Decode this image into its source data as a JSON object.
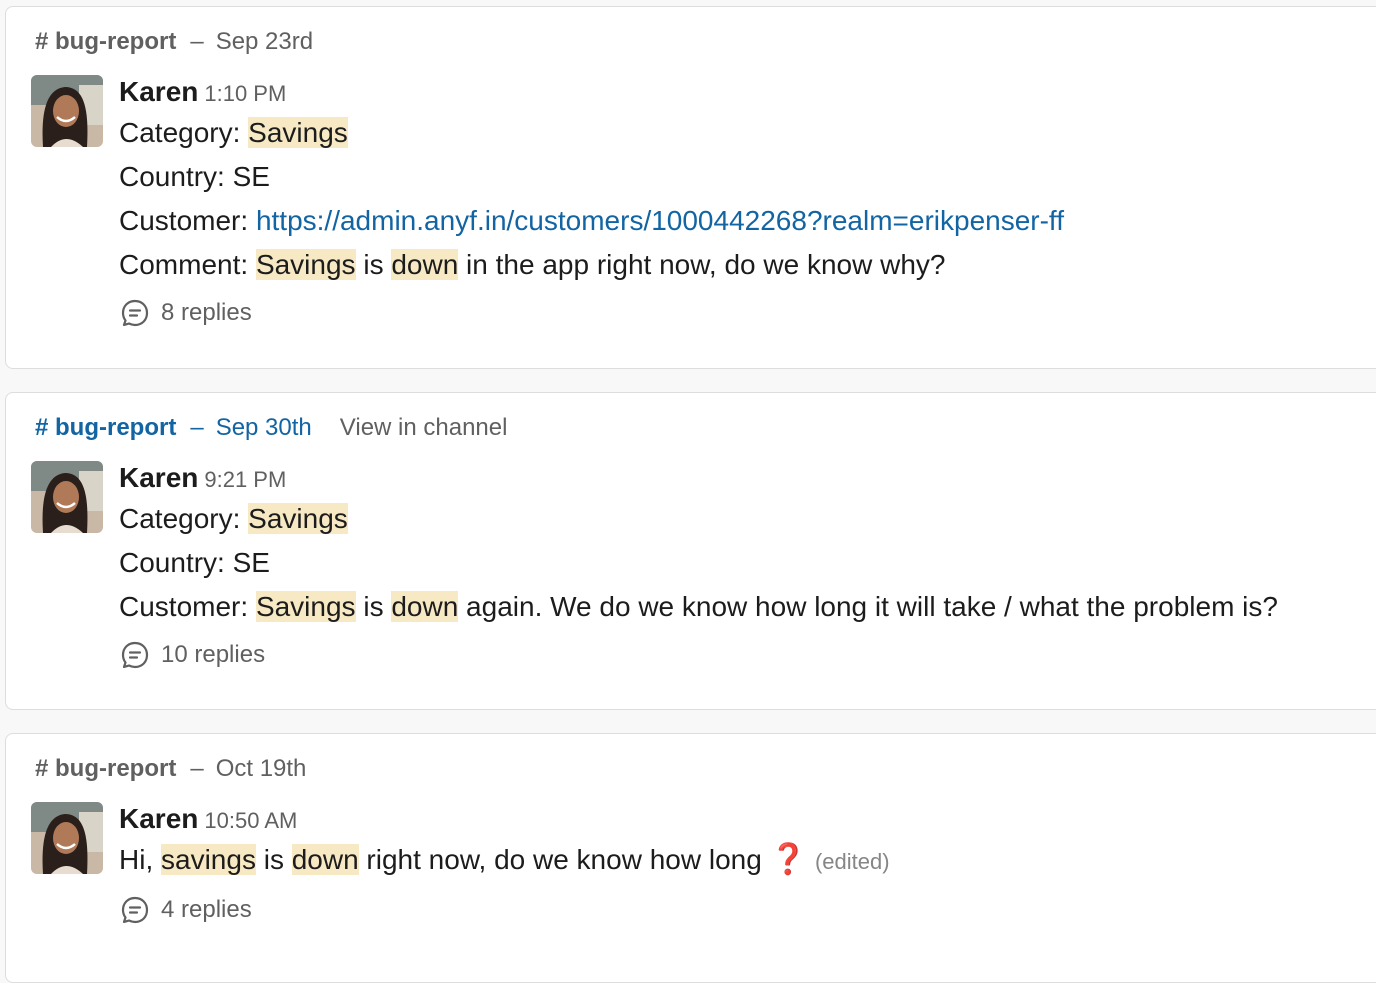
{
  "colors": {
    "link": "#1264a3",
    "highlight": "#f6e9c3",
    "muted": "#616061"
  },
  "results": [
    {
      "channel": "# bug-report",
      "separator": "–",
      "date": "Sep 23rd",
      "author": "Karen",
      "time": "1:10 PM",
      "lines": {
        "category_label": "Category: ",
        "category_value": "Savings",
        "country": "Country: SE",
        "customer_label": "Customer: ",
        "customer_url": "https://admin.anyf.in/customers/1000442268?realm=erikpenser-ff",
        "comment_label": "Comment: ",
        "w_savings": "Savings",
        "w_is": " is ",
        "w_down": "down",
        "comment_rest": " in the app right now, do we know why?"
      },
      "replies": "8 replies"
    },
    {
      "channel": "# bug-report",
      "separator": "–",
      "date": "Sep 30th",
      "view_in_channel": "View in channel",
      "author": "Karen",
      "time": "9:21 PM",
      "lines": {
        "category_label": "Category: ",
        "category_value": "Savings",
        "country": "Country: SE",
        "customer_label": "Customer: ",
        "w_savings": "Savings",
        "w_is": " is ",
        "w_down": "down",
        "customer_rest": " again. We do we know how long it will take / what the problem is?"
      },
      "replies": "10 replies"
    },
    {
      "channel": "# bug-report",
      "separator": "–",
      "date": "Oct 19th",
      "author": "Karen",
      "time": "10:50 AM",
      "lines": {
        "hi": "Hi, ",
        "w_savings": "savings",
        "w_is": " is ",
        "w_down": "down",
        "rest": " right now, do we know how long",
        "emoji": "❓",
        "edited": "(edited)"
      },
      "replies": "4 replies"
    }
  ]
}
